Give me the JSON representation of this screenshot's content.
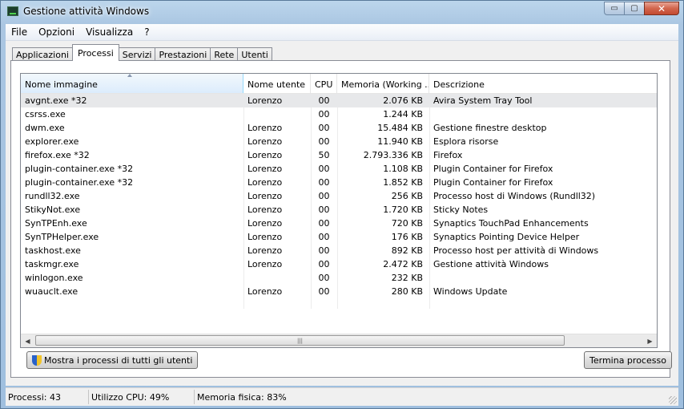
{
  "window": {
    "title": "Gestione attività Windows"
  },
  "caption": {
    "minimize": "▭",
    "maximize": "▢",
    "close": "✕"
  },
  "menu": [
    "File",
    "Opzioni",
    "Visualizza",
    "?"
  ],
  "tabs": [
    "Applicazioni",
    "Processi",
    "Servizi",
    "Prestazioni",
    "Rete",
    "Utenti"
  ],
  "active_tab": "Processi",
  "table": {
    "columns": [
      "Nome immagine",
      "Nome utente",
      "CPU",
      "Memoria (Working ...",
      "Descrizione"
    ],
    "rows": [
      [
        "avgnt.exe *32",
        "Lorenzo",
        "00",
        "2.076 KB",
        "Avira System Tray Tool"
      ],
      [
        "csrss.exe",
        "",
        "00",
        "1.244 KB",
        ""
      ],
      [
        "dwm.exe",
        "Lorenzo",
        "00",
        "15.484 KB",
        "Gestione finestre desktop"
      ],
      [
        "explorer.exe",
        "Lorenzo",
        "00",
        "11.940 KB",
        "Esplora risorse"
      ],
      [
        "firefox.exe *32",
        "Lorenzo",
        "50",
        "2.793.336 KB",
        "Firefox"
      ],
      [
        "plugin-container.exe *32",
        "Lorenzo",
        "00",
        "1.108 KB",
        "Plugin Container for Firefox"
      ],
      [
        "plugin-container.exe *32",
        "Lorenzo",
        "00",
        "1.852 KB",
        "Plugin Container for Firefox"
      ],
      [
        "rundll32.exe",
        "Lorenzo",
        "00",
        "256 KB",
        "Processo host di Windows (Rundll32)"
      ],
      [
        "StikyNot.exe",
        "Lorenzo",
        "00",
        "1.720 KB",
        "Sticky Notes"
      ],
      [
        "SynTPEnh.exe",
        "Lorenzo",
        "00",
        "720 KB",
        "Synaptics TouchPad Enhancements"
      ],
      [
        "SynTPHelper.exe",
        "Lorenzo",
        "00",
        "176 KB",
        "Synaptics Pointing Device Helper"
      ],
      [
        "taskhost.exe",
        "Lorenzo",
        "00",
        "892 KB",
        "Processo host per attività di Windows"
      ],
      [
        "taskmgr.exe",
        "Lorenzo",
        "00",
        "2.472 KB",
        "Gestione attività Windows"
      ],
      [
        "winlogon.exe",
        "",
        "00",
        "232 KB",
        ""
      ],
      [
        "wuauclt.exe",
        "Lorenzo",
        "00",
        "280 KB",
        "Windows Update"
      ]
    ]
  },
  "scroll": {
    "left": "◀",
    "right": "▶",
    "grip": "|||"
  },
  "buttons": {
    "show_all": "Mostra i processi di tutti gli utenti",
    "end_process": "Termina processo"
  },
  "status": {
    "processes": "Processi: 43",
    "cpu": "Utilizzo CPU: 49%",
    "memory": "Memoria fisica: 83%"
  }
}
